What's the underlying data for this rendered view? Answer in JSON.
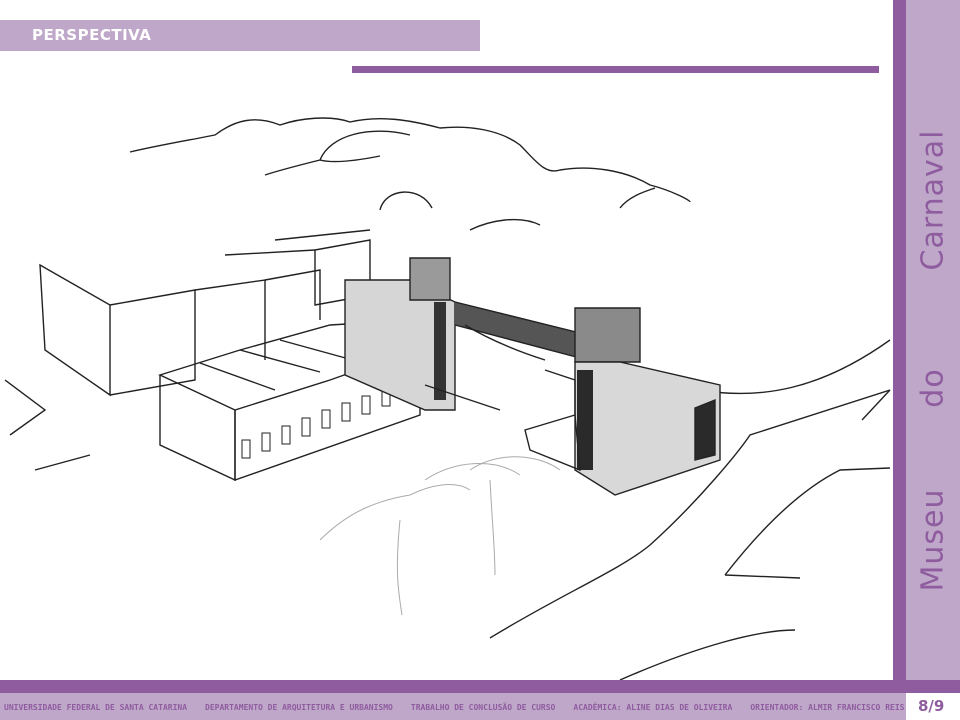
{
  "header": {
    "title": "PERSPECTIVA"
  },
  "side_title": {
    "word1": "Museu",
    "word2": "do",
    "word3": "Carnaval"
  },
  "footer": {
    "items": [
      "UNIVERSIDADE FEDERAL DE SANTA CATARINA",
      "DEPARTAMENTO DE ARQUITETURA E URBANISMO",
      "TRABALHO DE CONCLUSÃO DE CURSO",
      "ACADÊMICA: ALINE DIAS DE OLIVEIRA",
      "ORIENTADOR: ALMIR FRANCISCO REIS"
    ],
    "page": "8/9"
  },
  "colors": {
    "accent_dark": "#8f5c9f",
    "accent_light": "#bea7c8"
  }
}
